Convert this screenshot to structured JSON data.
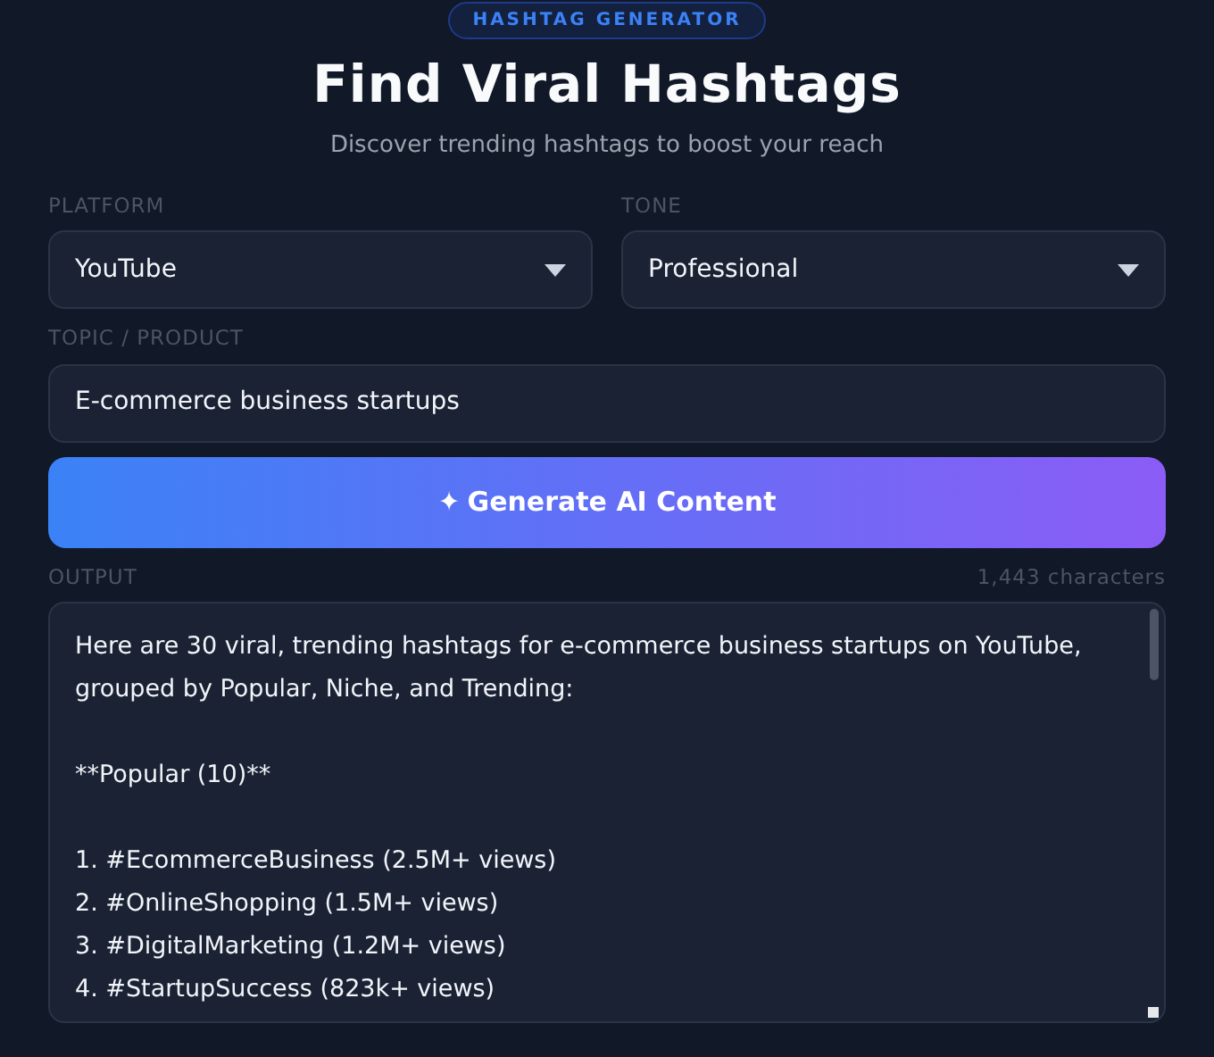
{
  "badge": "HASHTAG GENERATOR",
  "title": "Find Viral Hashtags",
  "subtitle": "Discover trending hashtags to boost your reach",
  "selects": [
    {
      "label": "PLATFORM",
      "value": "YouTube"
    },
    {
      "label": "TONE",
      "value": "Professional"
    }
  ],
  "topic": {
    "label": "TOPIC / PRODUCT",
    "value": "E-commerce business startups"
  },
  "generate_button": {
    "icon": "✦",
    "label": "Generate AI Content"
  },
  "output": {
    "label": "OUTPUT",
    "count": "1,443 characters",
    "paragraphs": [
      [
        "Here are 30 viral, trending hashtags for e-commerce business startups on YouTube, grouped by Popular, Niche, and Trending:"
      ],
      [
        "**Popular (10)**"
      ],
      [
        "1. #EcommerceBusiness (2.5M+ views)",
        "2. #OnlineShopping (1.5M+ views)",
        "3. #DigitalMarketing (1.2M+ views)",
        "4. #StartupSuccess (823k+ views)"
      ]
    ]
  }
}
